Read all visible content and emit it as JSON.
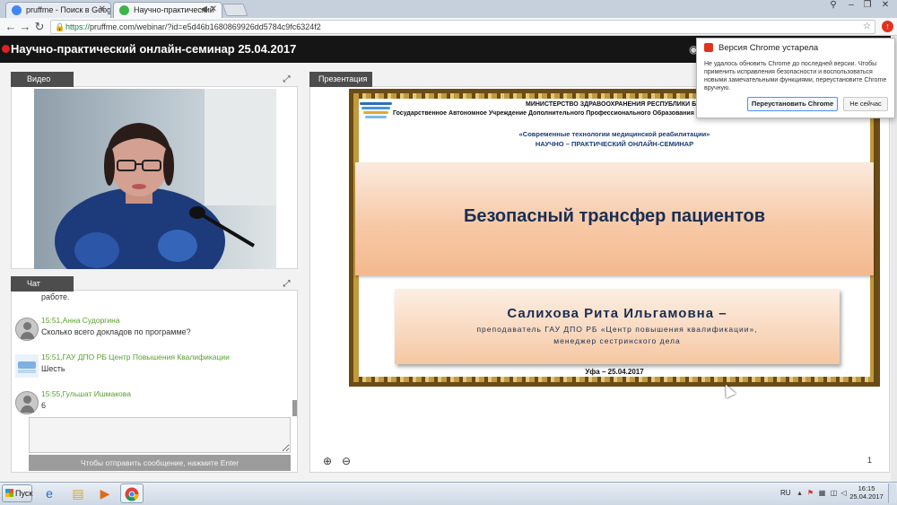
{
  "browser": {
    "tabs": [
      {
        "label": "pruffme - Поиск в Google",
        "favicon_color": "#4285f4"
      },
      {
        "label": "Научно-практический",
        "favicon_color": "#3bb54a"
      }
    ],
    "address": {
      "scheme": "https://",
      "host_path": "pruffme.com/webinar/?id=e5d46b1680869926dd5784c9fc6324f2"
    },
    "icons": {
      "back": "back-arrow-icon",
      "forward": "forward-arrow-icon",
      "reload": "reload-icon",
      "lock": "lock-icon",
      "star": "star-icon",
      "menu_alert": "chrome-update-alert-icon"
    }
  },
  "header": {
    "title": "Научно-практический онлайн-семинар 25.04.2017"
  },
  "video_panel": {
    "label": "Видео"
  },
  "chat_panel": {
    "label": "Чат",
    "partial_text": "работе.",
    "messages": [
      {
        "time": "15:51,",
        "author": "Анна Судоргина",
        "text": "Сколько всего докладов по программе?",
        "avatar": "user"
      },
      {
        "time": "15:51,",
        "author": "ГАУ ДПО РБ Центр Повышения Квалификации",
        "text": "Шесть",
        "avatar": "org"
      },
      {
        "time": "15:55,",
        "author": "Гульшат Ишмакова",
        "text": "6",
        "avatar": "user"
      }
    ],
    "input_hint": "Чтобы отправить сообщение, нажмите Enter"
  },
  "presentation_panel": {
    "label": "Презентация",
    "page_number": "1",
    "slide": {
      "ministry": "МИНИСТЕРСТВО ЗДРАВООХРАНЕНИЯ РЕСПУБЛИКИ БАШКОРТОСТАН",
      "organization": "Государственное Автономное Учреждение Дополнительного Профессионального Образования Республики Башкортостан",
      "topic": "«Современные технологии медицинской реабилитации»",
      "event_type": "НАУЧНО – ПРАКТИЧЕСКИЙ ОНЛАЙН-СЕМИНАР",
      "title": "Безопасный трансфер пациентов",
      "speaker": "Салихова Рита Ильгамовна –",
      "position_line1": "преподаватель ГАУ ДПО РБ «Центр повышения квалификации»,",
      "position_line2": "менеджер сестринского дела",
      "place_date": "Уфа – 25.04.2017"
    }
  },
  "chrome_bubble": {
    "title": "Версия Chrome устарела",
    "body": "Не удалось обновить Chrome до последней версии. Чтобы применить исправления безопасности и воспользоваться новыми замечательными функциями, переустановите Chrome вручную.",
    "reinstall_label": "Переустановить Chrome",
    "later_label": "Не сейчас"
  },
  "taskbar": {
    "start_label": "Пуск",
    "lang": "RU",
    "time": "16:15",
    "date": "25.04.2017"
  }
}
